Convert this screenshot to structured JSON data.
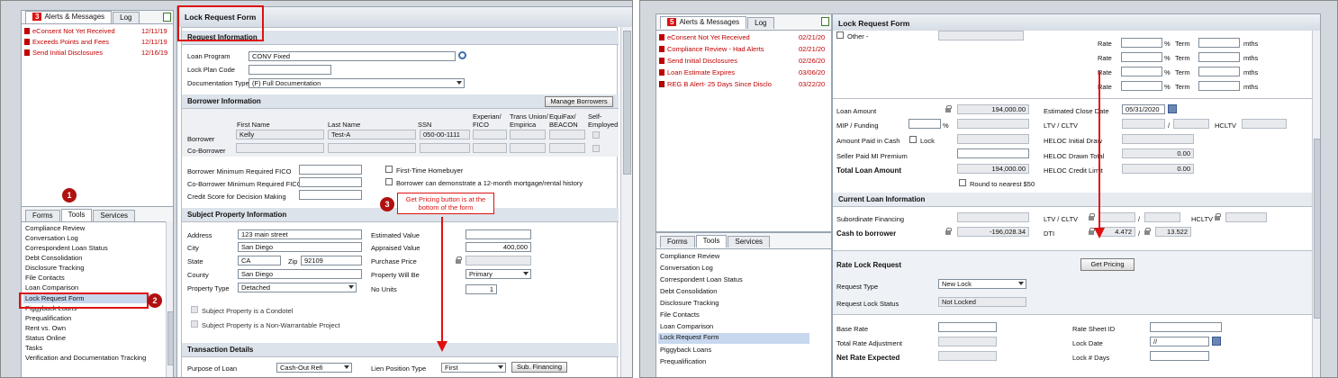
{
  "left": {
    "alerts_tab": "Alerts & Messages",
    "alerts_count": "3",
    "log_tab": "Log",
    "alerts": [
      {
        "text": "eConsent Not Yet Received",
        "date": "12/11/19"
      },
      {
        "text": "Exceeds Points and Fees",
        "date": "12/11/19"
      },
      {
        "text": "Send Initial Disclosures",
        "date": "12/16/19"
      }
    ],
    "bottom_tabs": [
      "Forms",
      "Tools",
      "Services"
    ],
    "tools": [
      "Compliance Review",
      "Conversation Log",
      "Correspondent Loan Status",
      "Debt Consolidation",
      "Disclosure Tracking",
      "File Contacts",
      "Loan Comparison",
      "Lock Request Form",
      "Piggyback Loans",
      "Prequalification",
      "Rent vs. Own",
      "Status Online",
      "Tasks",
      "Verification and Documentation Tracking"
    ],
    "markers": {
      "m1": "1",
      "m2": "2",
      "m3": "3"
    },
    "callout": "Get Pricing button is at the bottom of the form",
    "form_title": "Lock Request Form",
    "request_info": "Request Information",
    "loan_program_label": "Loan Program",
    "loan_program": "CONV Fixed",
    "lock_plan_label": "Lock Plan Code",
    "doc_type_label": "Documentation Type",
    "doc_type": "(F) Full Documentation",
    "borrower_info": "Borrower Information",
    "manage_borrowers": "Manage Borrowers",
    "cols": {
      "first": "First Name",
      "last": "Last Name",
      "ssn": "SSN",
      "exp1": "Experian/",
      "exp2": "FICO",
      "tu1": "Trans Union/",
      "tu2": "Empirica",
      "eq1": "EquiFax/",
      "eq2": "BEACON",
      "se1": "Self-",
      "se2": "Employed"
    },
    "borrower_label": "Borrower",
    "coborrower_label": "Co-Borrower",
    "borrower_first": "Kelly",
    "borrower_last": "Test-A",
    "borrower_ssn": "050-00-1111",
    "min_fico": "Borrower Minimum Required FICO",
    "co_min_fico": "Co-Borrower Minimum Required FICO",
    "credit_score": "Credit Score for Decision Making",
    "first_time": "First-Time Homebuyer",
    "mortgage_hist": "Borrower can demonstrate a 12-month mortgage/rental history",
    "subject_prop": "Subject Property Information",
    "address_label": "Address",
    "address": "123 main street",
    "city_label": "City",
    "city": "San Diego",
    "state_label": "State",
    "state": "CA",
    "zip_label": "Zip",
    "zip": "92109",
    "county_label": "County",
    "county": "San Diego",
    "prop_type_label": "Property Type",
    "prop_type": "Detached",
    "est_value": "Estimated Value",
    "appraised": "Appraised Value",
    "appraised_val": "400,000",
    "purchase_price": "Purchase Price",
    "prop_will_be": "Property Will Be",
    "prop_will_be_val": "Primary",
    "no_units": "No Units",
    "no_units_val": "1",
    "condotel": "Subject Property is a Condotel",
    "nonwarrant": "Subject Property is a Non-Warrantable Project",
    "transaction": "Transaction Details",
    "purpose": "Purpose of Loan",
    "purpose_val": "Cash-Out Refi",
    "lien": "Lien Position Type",
    "lien_val": "First",
    "sub_fin_btn": "Sub. Financing"
  },
  "right": {
    "alerts_tab": "Alerts & Messages",
    "alerts_count": "5",
    "log_tab": "Log",
    "alerts": [
      {
        "text": "eConsent Not Yet Received",
        "date": "02/21/20"
      },
      {
        "text": "Compliance Review - Had Alerts",
        "date": "02/21/20"
      },
      {
        "text": "Send Initial Disclosures",
        "date": "02/26/20"
      },
      {
        "text": "Loan Estimate Expires",
        "date": "03/06/20"
      },
      {
        "text": "REG B Alert- 25 Days Since Disclo",
        "date": "03/22/20"
      }
    ],
    "bottom_tabs": [
      "Forms",
      "Tools",
      "Services"
    ],
    "tools": [
      "Compliance Review",
      "Conversation Log",
      "Correspondent Loan Status",
      "Debt Consolidation",
      "Disclosure Tracking",
      "File Contacts",
      "Loan Comparison",
      "Lock Request Form",
      "Piggyback Loans",
      "Prequalification"
    ],
    "form_title": "Lock Request Form",
    "other": "Other -",
    "rate": "Rate",
    "pct": "%",
    "term": "Term",
    "mths": "mths",
    "loan_amount": "Loan Amount",
    "loan_amount_val": "194,000.00",
    "mip": "MIP / Funding",
    "paid_cash": "Amount Paid in Cash",
    "lock": "Lock",
    "seller_mi": "Seller Paid MI Premium",
    "total_loan": "Total Loan Amount",
    "total_loan_val": "194,000.00",
    "round": "Round to nearest $50",
    "est_close": "Estimated Close Date",
    "est_close_val": "05/31/2020",
    "ltv": "LTV / CLTV",
    "slash": "/",
    "hcltv": "HCLTV",
    "heloc_initial": "HELOC Initial Draw",
    "heloc_drawn": "HELOC Drawn Total",
    "heloc_drawn_val": "0.00",
    "heloc_credit": "HELOC Credit Limit",
    "heloc_credit_val": "0.00",
    "current_loan": "Current Loan Information",
    "sub_fin": "Subordinate Financing",
    "cash_borrower": "Cash to borrower",
    "cash_borrower_val": "-196,028.34",
    "dti": "DTI",
    "dti1": "4.472",
    "dti2": "13.522",
    "rate_lock": "Rate Lock Request",
    "get_pricing": "Get Pricing",
    "req_type": "Request Type",
    "req_type_val": "New Lock",
    "req_status": "Request Lock Status",
    "req_status_val": "Not Locked",
    "base_rate": "Base Rate",
    "total_adj": "Total Rate Adjustment",
    "net_rate": "Net Rate Expected",
    "rate_sheet": "Rate Sheet ID",
    "lock_date": "Lock Date",
    "lock_date_val": "//",
    "lock_days": "Lock # Days"
  }
}
